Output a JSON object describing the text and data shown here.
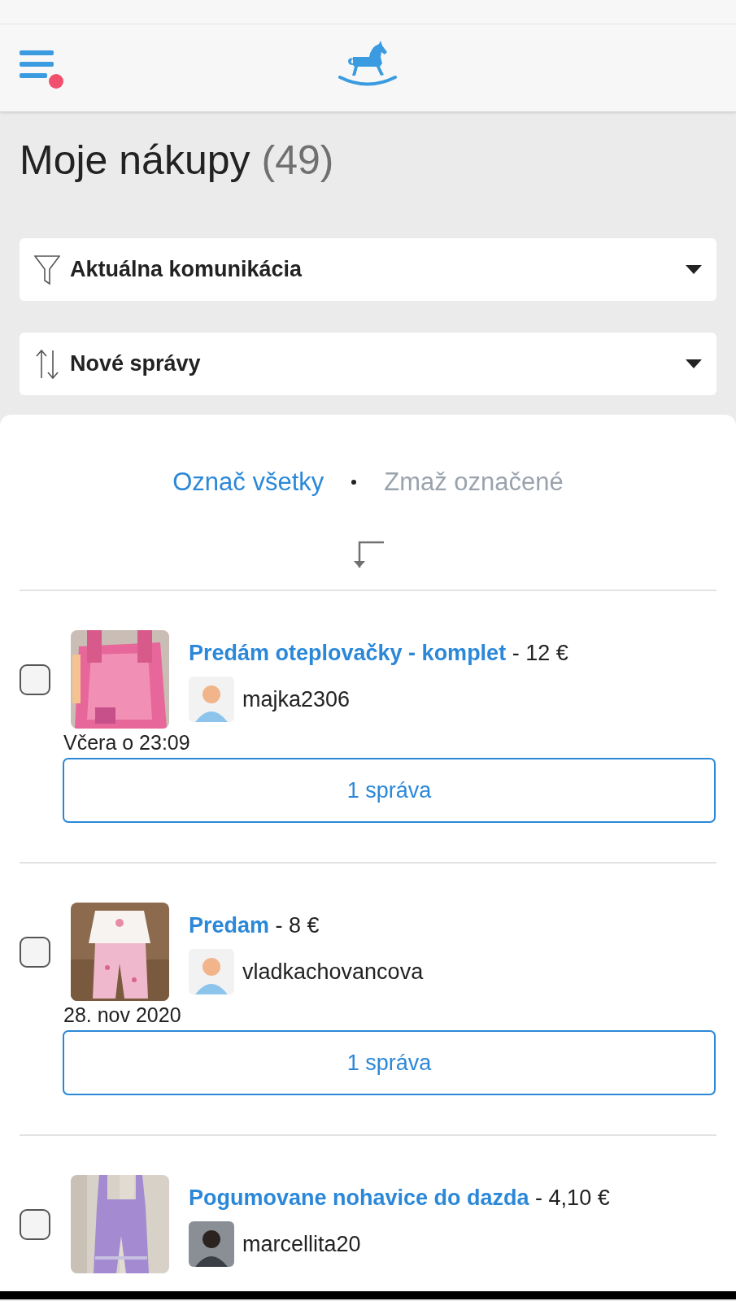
{
  "page_title": "Moje nákupy",
  "count": "(49)",
  "filters": [
    {
      "kind": "filter",
      "label": "Aktuálna komunikácia"
    },
    {
      "kind": "sort",
      "label": "Nové správy"
    }
  ],
  "actions": [
    {
      "label": "Označ všetky",
      "disabled": false
    },
    {
      "label": "Zmaž označené",
      "disabled": true
    }
  ],
  "items": [
    {
      "checked": false,
      "title": "Predám oteplovačky - komplet",
      "price": "- 12 €",
      "seller": "majka2306",
      "date": "Včera o 23:09",
      "button": "1 správa"
    },
    {
      "checked": false,
      "title": "Predam",
      "price": "- 8 €",
      "seller": "vladkachovancova",
      "date": "28. nov 2020",
      "button": "1 správa"
    },
    {
      "checked": false,
      "title": "Pogumovane nohavice do dazda",
      "price": "- 4,10 €",
      "seller": "marcellita20"
    }
  ]
}
